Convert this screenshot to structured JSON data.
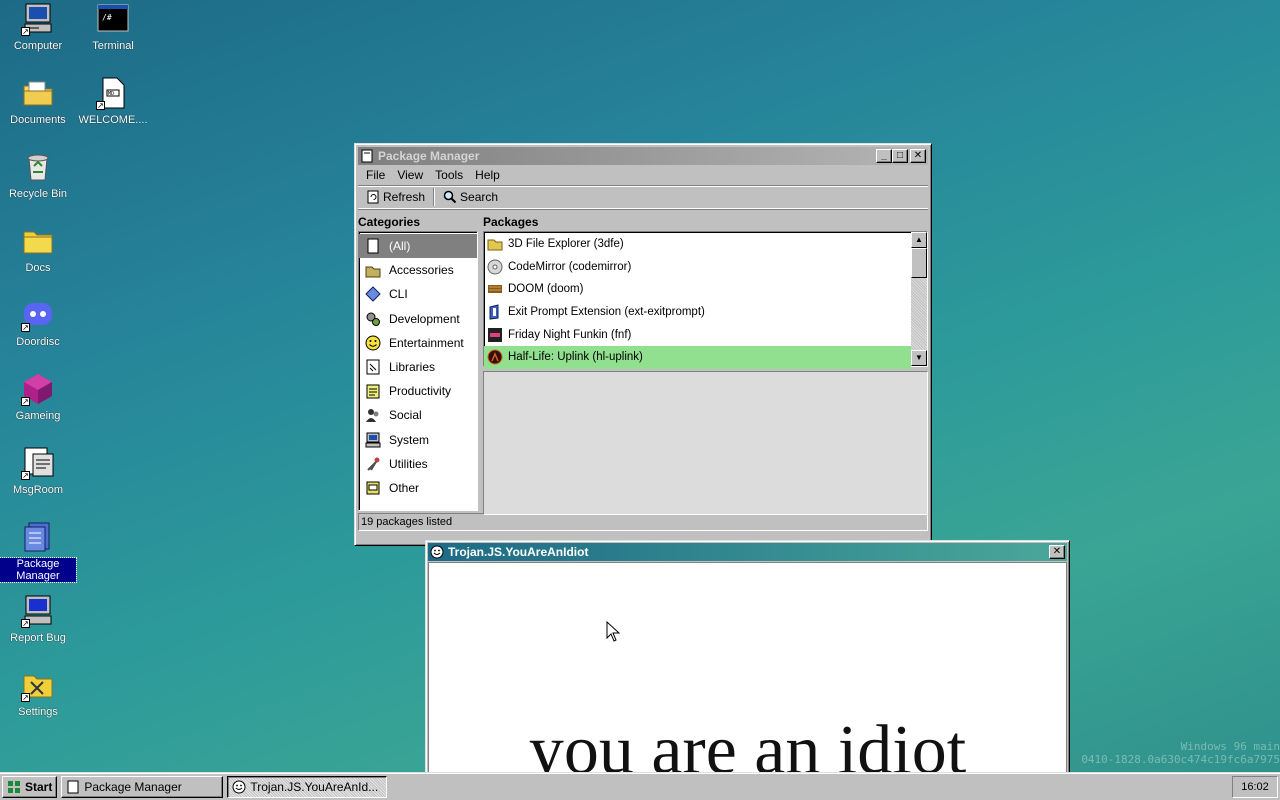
{
  "desktop": {
    "icons": [
      {
        "label": "Computer"
      },
      {
        "label": "Terminal"
      },
      {
        "label": "Documents"
      },
      {
        "label": "WELCOME...."
      },
      {
        "label": "Recycle Bin"
      },
      {
        "label": "Docs"
      },
      {
        "label": "Doordisc"
      },
      {
        "label": "Gameing"
      },
      {
        "label": "MsgRoom"
      },
      {
        "label": "Package Manager"
      },
      {
        "label": "Report Bug"
      },
      {
        "label": "Settings"
      }
    ],
    "selected_icon": "Package Manager"
  },
  "package_manager": {
    "title": "Package Manager",
    "menu": [
      "File",
      "View",
      "Tools",
      "Help"
    ],
    "toolbar": {
      "refresh": "Refresh",
      "search": "Search"
    },
    "categories_heading": "Categories",
    "packages_heading": "Packages",
    "categories": [
      {
        "label": "(All)",
        "icon": "package-icon"
      },
      {
        "label": "Accessories",
        "icon": "accessories-icon"
      },
      {
        "label": "CLI",
        "icon": "diamond-icon"
      },
      {
        "label": "Development",
        "icon": "development-icon"
      },
      {
        "label": "Entertainment",
        "icon": "smiley-icon"
      },
      {
        "label": "Libraries",
        "icon": "library-icon"
      },
      {
        "label": "Productivity",
        "icon": "notepad-icon"
      },
      {
        "label": "Social",
        "icon": "social-icon"
      },
      {
        "label": "System",
        "icon": "computer-icon"
      },
      {
        "label": "Utilities",
        "icon": "utilities-icon"
      },
      {
        "label": "Other",
        "icon": "other-icon"
      }
    ],
    "selected_category": "(All)",
    "packages": [
      {
        "label": "3D File Explorer (3dfe)",
        "icon": "folder-icon"
      },
      {
        "label": "CodeMirror (codemirror)",
        "icon": "disc-icon"
      },
      {
        "label": "DOOM (doom)",
        "icon": "doom-icon"
      },
      {
        "label": "Exit Prompt Extension (ext-exitprompt)",
        "icon": "extension-icon"
      },
      {
        "label": "Friday Night Funkin (fnf)",
        "icon": "fnf-icon"
      },
      {
        "label": "Half-Life: Uplink (hl-uplink)",
        "icon": "half-life-icon"
      }
    ],
    "selected_package": "Half-Life: Uplink (hl-uplink)",
    "status": "19 packages listed"
  },
  "trojan_window": {
    "title": "Trojan.JS.YouAreAnIdiot",
    "message": "you are an idiot"
  },
  "watermark": {
    "line1": "Windows 96 main",
    "line2": "0410-1828.0a630c474c19fc6a7975"
  },
  "taskbar": {
    "start": "Start",
    "tasks": [
      "Package Manager",
      "Trojan.JS.YouAreAnId..."
    ],
    "clock": "16:02"
  },
  "colors": {
    "desktop": "#2a8a98",
    "selection": "#90e090",
    "title_active": "#1d6a86"
  }
}
